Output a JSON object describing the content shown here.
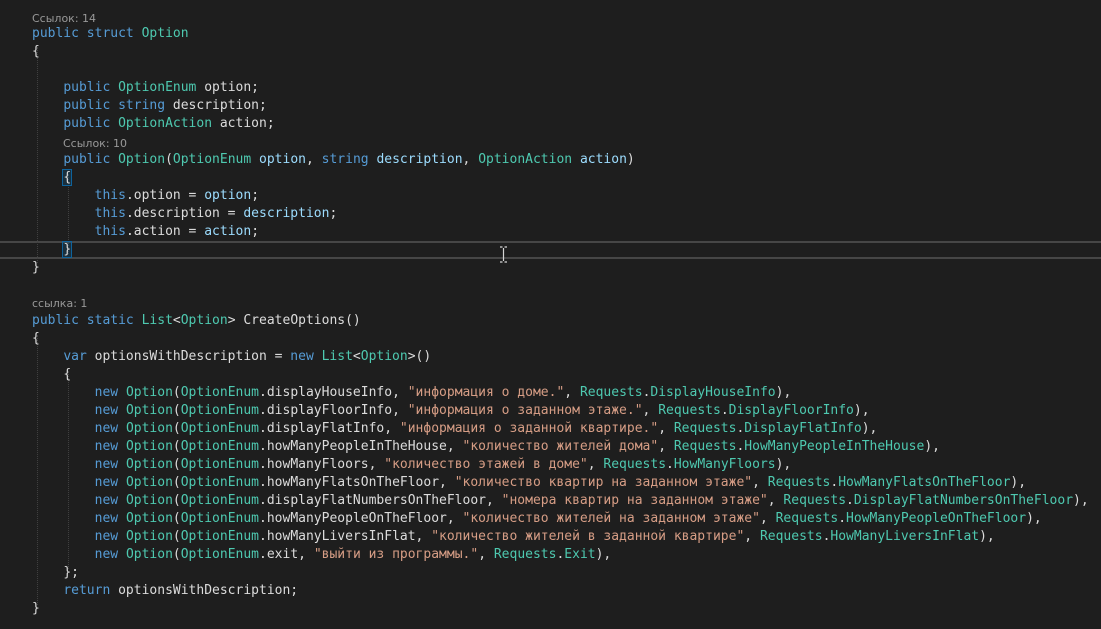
{
  "editor": {
    "lenses": [
      "Ссылок: 14",
      "Ссылок: 10",
      "ссылка: 1"
    ],
    "lines": [
      [
        [
          "k",
          "public"
        ],
        [
          "sp",
          " "
        ],
        [
          "k",
          "struct"
        ],
        [
          "sp",
          " "
        ],
        [
          "t",
          "Option"
        ]
      ],
      [
        [
          "id",
          "{"
        ]
      ],
      [],
      [
        [
          "sp",
          "    "
        ],
        [
          "k",
          "public"
        ],
        [
          "sp",
          " "
        ],
        [
          "t",
          "OptionEnum"
        ],
        [
          "sp",
          " "
        ],
        [
          "id",
          "option;"
        ]
      ],
      [
        [
          "sp",
          "    "
        ],
        [
          "k",
          "public"
        ],
        [
          "sp",
          " "
        ],
        [
          "k",
          "string"
        ],
        [
          "sp",
          " "
        ],
        [
          "id",
          "description;"
        ]
      ],
      [
        [
          "sp",
          "    "
        ],
        [
          "k",
          "public"
        ],
        [
          "sp",
          " "
        ],
        [
          "t",
          "OptionAction"
        ],
        [
          "sp",
          " "
        ],
        [
          "id",
          "action;"
        ]
      ],
      [],
      [
        [
          "sp",
          "    "
        ],
        [
          "k",
          "public"
        ],
        [
          "sp",
          " "
        ],
        [
          "t",
          "Option"
        ],
        [
          "id",
          "("
        ],
        [
          "t",
          "OptionEnum"
        ],
        [
          "sp",
          " "
        ],
        [
          "p",
          "option"
        ],
        [
          "id",
          ", "
        ],
        [
          "k",
          "string"
        ],
        [
          "sp",
          " "
        ],
        [
          "p",
          "description"
        ],
        [
          "id",
          ", "
        ],
        [
          "t",
          "OptionAction"
        ],
        [
          "sp",
          " "
        ],
        [
          "p",
          "action"
        ],
        [
          "id",
          ")"
        ]
      ],
      [
        [
          "sp",
          "    "
        ],
        [
          "id",
          "{"
        ]
      ],
      [
        [
          "sp",
          "        "
        ],
        [
          "k",
          "this"
        ],
        [
          "id",
          ".option = "
        ],
        [
          "p",
          "option"
        ],
        [
          "id",
          ";"
        ]
      ],
      [
        [
          "sp",
          "        "
        ],
        [
          "k",
          "this"
        ],
        [
          "id",
          ".description = "
        ],
        [
          "p",
          "description"
        ],
        [
          "id",
          ";"
        ]
      ],
      [
        [
          "sp",
          "        "
        ],
        [
          "k",
          "this"
        ],
        [
          "id",
          ".action = "
        ],
        [
          "p",
          "action"
        ],
        [
          "id",
          ";"
        ]
      ],
      [
        [
          "sp",
          "    "
        ],
        [
          "id",
          "}"
        ]
      ],
      [
        [
          "id",
          "}"
        ]
      ],
      [],
      [
        [
          "k",
          "public"
        ],
        [
          "sp",
          " "
        ],
        [
          "k",
          "static"
        ],
        [
          "sp",
          " "
        ],
        [
          "t",
          "List"
        ],
        [
          "id",
          "<"
        ],
        [
          "t",
          "Option"
        ],
        [
          "id",
          "> "
        ],
        [
          "id",
          "CreateOptions()"
        ]
      ],
      [
        [
          "id",
          "{"
        ]
      ],
      [
        [
          "sp",
          "    "
        ],
        [
          "k",
          "var"
        ],
        [
          "sp",
          " "
        ],
        [
          "id",
          "optionsWithDescription = "
        ],
        [
          "k",
          "new"
        ],
        [
          "sp",
          " "
        ],
        [
          "t",
          "List"
        ],
        [
          "id",
          "<"
        ],
        [
          "t",
          "Option"
        ],
        [
          "id",
          ">()"
        ]
      ],
      [
        [
          "sp",
          "    "
        ],
        [
          "id",
          "{"
        ]
      ],
      [
        [
          "sp",
          "        "
        ],
        [
          "k",
          "new"
        ],
        [
          "sp",
          " "
        ],
        [
          "t",
          "Option"
        ],
        [
          "id",
          "("
        ],
        [
          "t",
          "OptionEnum"
        ],
        [
          "id",
          ".displayHouseInfo, "
        ],
        [
          "s",
          "\"информация о доме.\""
        ],
        [
          "id",
          ", "
        ],
        [
          "t",
          "Requests"
        ],
        [
          "id",
          "."
        ],
        [
          "t",
          "DisplayHouseInfo"
        ],
        [
          "id",
          "),"
        ]
      ],
      [
        [
          "sp",
          "        "
        ],
        [
          "k",
          "new"
        ],
        [
          "sp",
          " "
        ],
        [
          "t",
          "Option"
        ],
        [
          "id",
          "("
        ],
        [
          "t",
          "OptionEnum"
        ],
        [
          "id",
          ".displayFloorInfo, "
        ],
        [
          "s",
          "\"информация о заданном этаже.\""
        ],
        [
          "id",
          ", "
        ],
        [
          "t",
          "Requests"
        ],
        [
          "id",
          "."
        ],
        [
          "t",
          "DisplayFloorInfo"
        ],
        [
          "id",
          "),"
        ]
      ],
      [
        [
          "sp",
          "        "
        ],
        [
          "k",
          "new"
        ],
        [
          "sp",
          " "
        ],
        [
          "t",
          "Option"
        ],
        [
          "id",
          "("
        ],
        [
          "t",
          "OptionEnum"
        ],
        [
          "id",
          ".displayFlatInfo, "
        ],
        [
          "s",
          "\"информация о заданной квартире.\""
        ],
        [
          "id",
          ", "
        ],
        [
          "t",
          "Requests"
        ],
        [
          "id",
          "."
        ],
        [
          "t",
          "DisplayFlatInfo"
        ],
        [
          "id",
          "),"
        ]
      ],
      [
        [
          "sp",
          "        "
        ],
        [
          "k",
          "new"
        ],
        [
          "sp",
          " "
        ],
        [
          "t",
          "Option"
        ],
        [
          "id",
          "("
        ],
        [
          "t",
          "OptionEnum"
        ],
        [
          "id",
          ".howManyPeopleInTheHouse, "
        ],
        [
          "s",
          "\"количество жителей дома\""
        ],
        [
          "id",
          ", "
        ],
        [
          "t",
          "Requests"
        ],
        [
          "id",
          "."
        ],
        [
          "t",
          "HowManyPeopleInTheHouse"
        ],
        [
          "id",
          "),"
        ]
      ],
      [
        [
          "sp",
          "        "
        ],
        [
          "k",
          "new"
        ],
        [
          "sp",
          " "
        ],
        [
          "t",
          "Option"
        ],
        [
          "id",
          "("
        ],
        [
          "t",
          "OptionEnum"
        ],
        [
          "id",
          ".howManyFloors, "
        ],
        [
          "s",
          "\"количество этажей в доме\""
        ],
        [
          "id",
          ", "
        ],
        [
          "t",
          "Requests"
        ],
        [
          "id",
          "."
        ],
        [
          "t",
          "HowManyFloors"
        ],
        [
          "id",
          "),"
        ]
      ],
      [
        [
          "sp",
          "        "
        ],
        [
          "k",
          "new"
        ],
        [
          "sp",
          " "
        ],
        [
          "t",
          "Option"
        ],
        [
          "id",
          "("
        ],
        [
          "t",
          "OptionEnum"
        ],
        [
          "id",
          ".howManyFlatsOnTheFloor, "
        ],
        [
          "s",
          "\"количество квартир на заданном этаже\""
        ],
        [
          "id",
          ", "
        ],
        [
          "t",
          "Requests"
        ],
        [
          "id",
          "."
        ],
        [
          "t",
          "HowManyFlatsOnTheFloor"
        ],
        [
          "id",
          "),"
        ]
      ],
      [
        [
          "sp",
          "        "
        ],
        [
          "k",
          "new"
        ],
        [
          "sp",
          " "
        ],
        [
          "t",
          "Option"
        ],
        [
          "id",
          "("
        ],
        [
          "t",
          "OptionEnum"
        ],
        [
          "id",
          ".displayFlatNumbersOnTheFloor, "
        ],
        [
          "s",
          "\"номера квартир на заданном этаже\""
        ],
        [
          "id",
          ", "
        ],
        [
          "t",
          "Requests"
        ],
        [
          "id",
          "."
        ],
        [
          "t",
          "DisplayFlatNumbersOnTheFloor"
        ],
        [
          "id",
          "),"
        ]
      ],
      [
        [
          "sp",
          "        "
        ],
        [
          "k",
          "new"
        ],
        [
          "sp",
          " "
        ],
        [
          "t",
          "Option"
        ],
        [
          "id",
          "("
        ],
        [
          "t",
          "OptionEnum"
        ],
        [
          "id",
          ".howManyPeopleOnTheFloor, "
        ],
        [
          "s",
          "\"количество жителей на заданном этаже\""
        ],
        [
          "id",
          ", "
        ],
        [
          "t",
          "Requests"
        ],
        [
          "id",
          "."
        ],
        [
          "t",
          "HowManyPeopleOnTheFloor"
        ],
        [
          "id",
          "),"
        ]
      ],
      [
        [
          "sp",
          "        "
        ],
        [
          "k",
          "new"
        ],
        [
          "sp",
          " "
        ],
        [
          "t",
          "Option"
        ],
        [
          "id",
          "("
        ],
        [
          "t",
          "OptionEnum"
        ],
        [
          "id",
          ".howManyLiversInFlat, "
        ],
        [
          "s",
          "\"количество жителей в заданной квартире\""
        ],
        [
          "id",
          ", "
        ],
        [
          "t",
          "Requests"
        ],
        [
          "id",
          "."
        ],
        [
          "t",
          "HowManyLiversInFlat"
        ],
        [
          "id",
          "),"
        ]
      ],
      [
        [
          "sp",
          "        "
        ],
        [
          "k",
          "new"
        ],
        [
          "sp",
          " "
        ],
        [
          "t",
          "Option"
        ],
        [
          "id",
          "("
        ],
        [
          "t",
          "OptionEnum"
        ],
        [
          "id",
          ".exit, "
        ],
        [
          "s",
          "\"выйти из программы.\""
        ],
        [
          "id",
          ", "
        ],
        [
          "t",
          "Requests"
        ],
        [
          "id",
          "."
        ],
        [
          "t",
          "Exit"
        ],
        [
          "id",
          "),"
        ]
      ],
      [
        [
          "sp",
          "    "
        ],
        [
          "id",
          "};"
        ]
      ],
      [
        [
          "sp",
          "    "
        ],
        [
          "k",
          "return"
        ],
        [
          "sp",
          " "
        ],
        [
          "id",
          "optionsWithDescription;"
        ]
      ],
      [
        [
          "id",
          "}"
        ]
      ]
    ]
  },
  "colors": {
    "keyword": "#569cd6",
    "type": "#4ec9b0",
    "string": "#d69d85",
    "parameter": "#9cdcfe",
    "text": "#dcdcdc",
    "background": "#1e1e1e",
    "codelens": "#999999"
  },
  "icons": {
    "cursor": "i-beam-cursor-icon"
  }
}
